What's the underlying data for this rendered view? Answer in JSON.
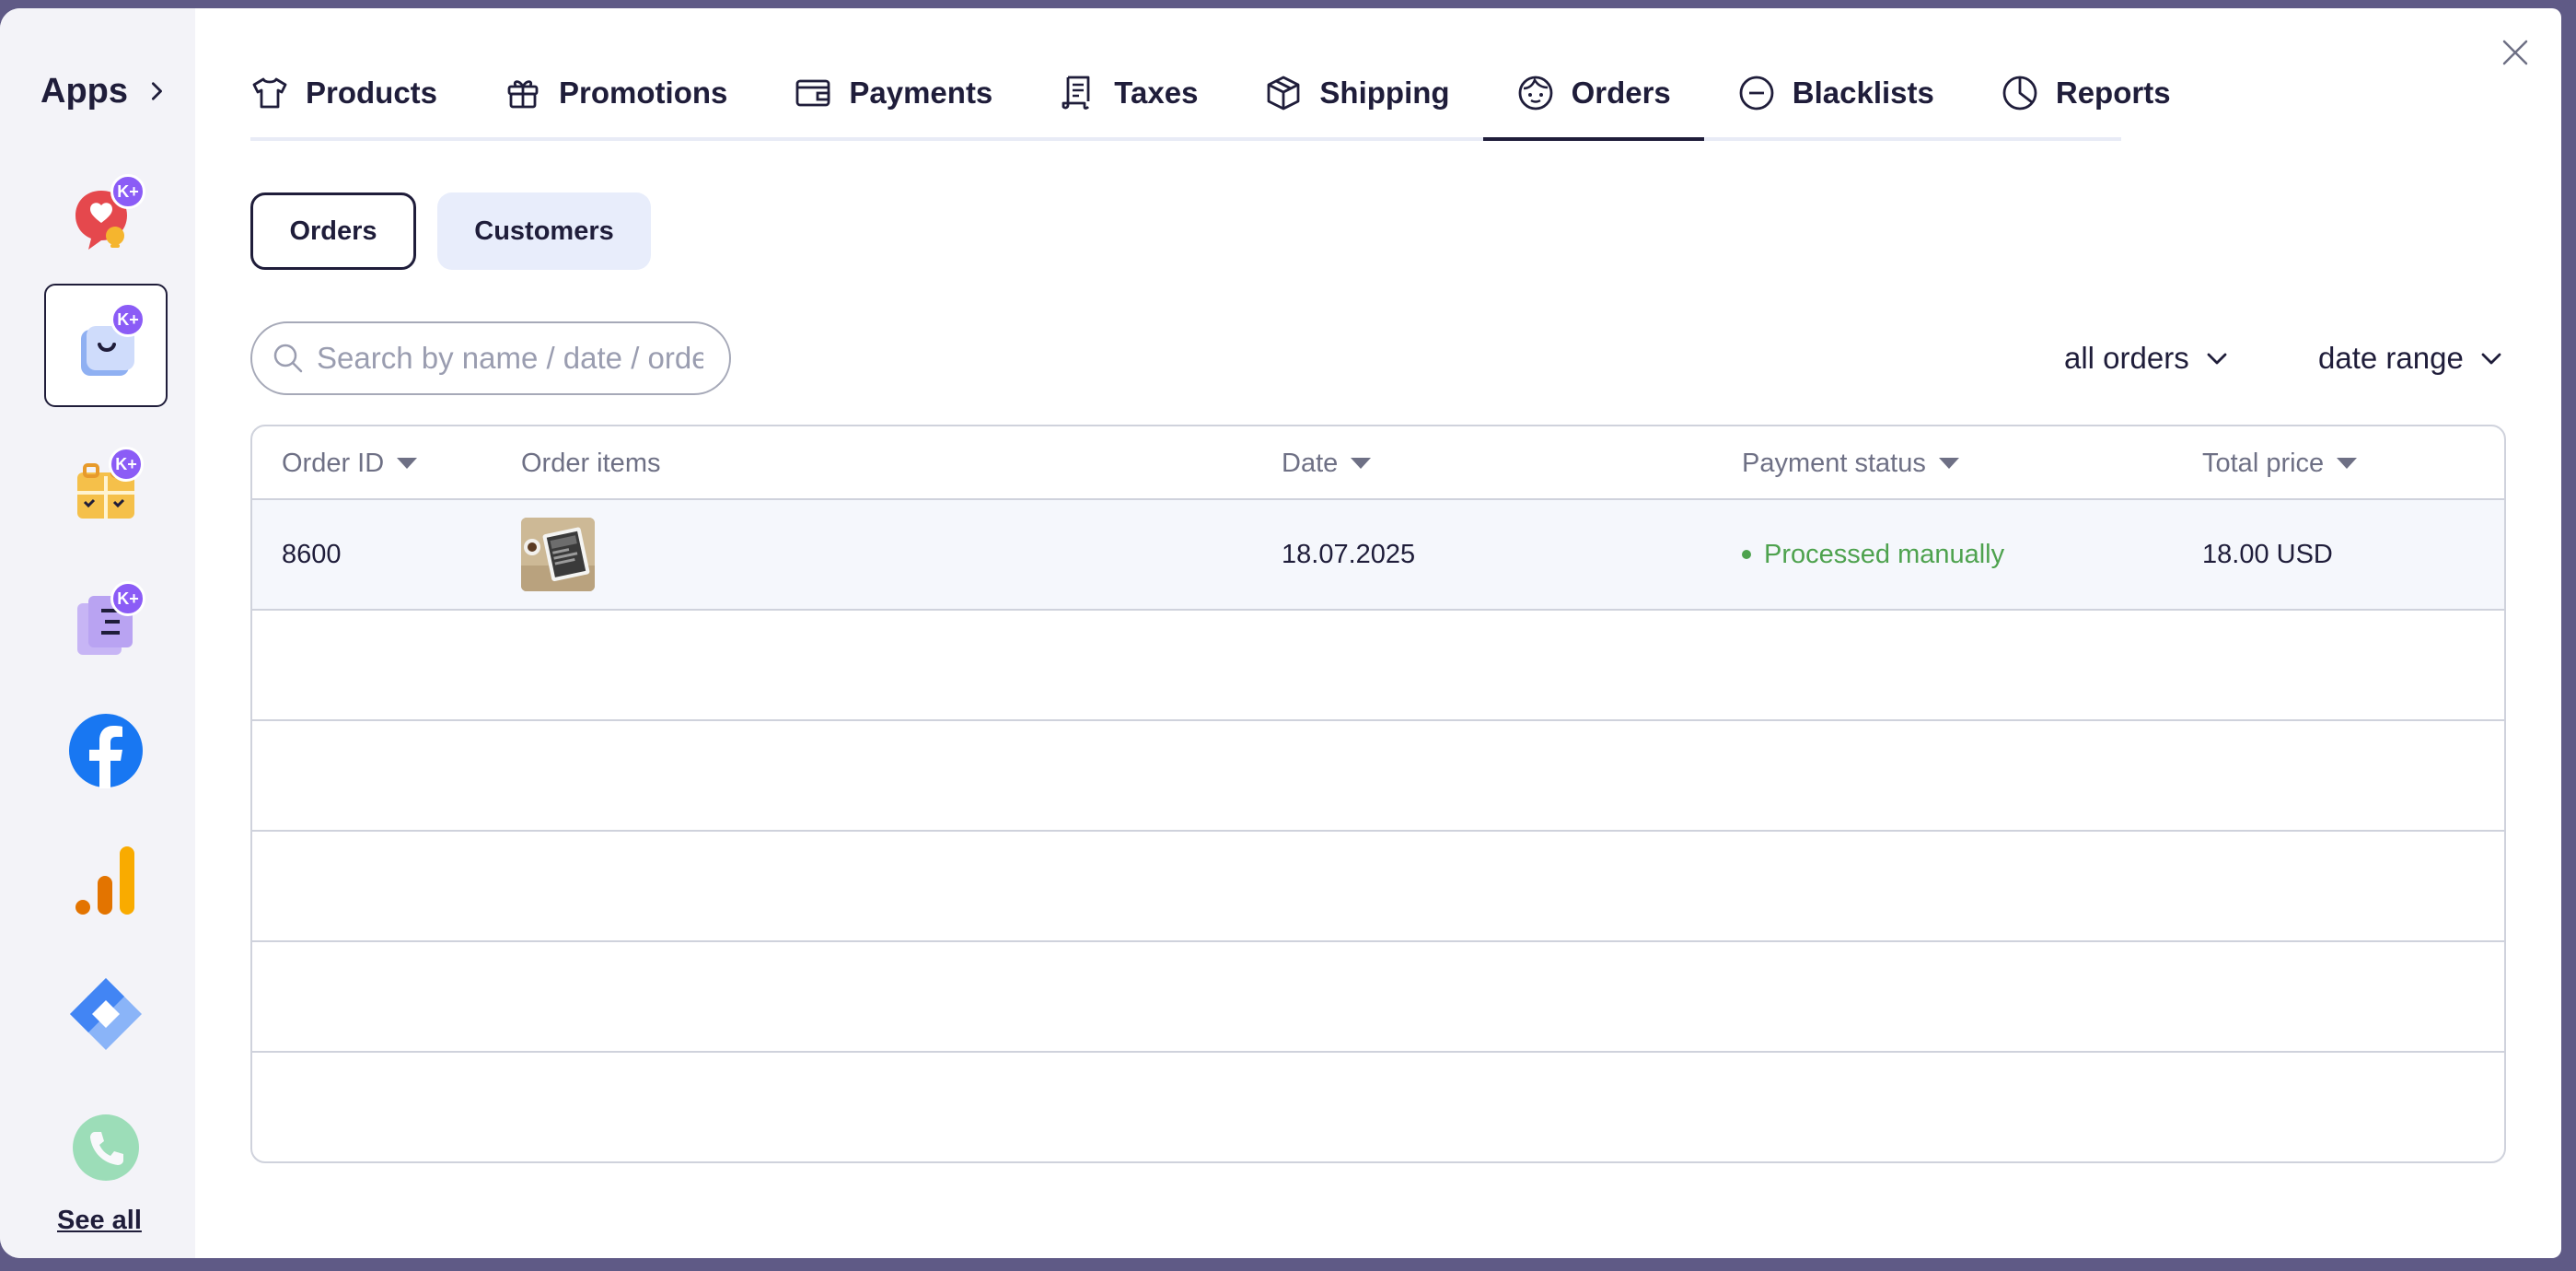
{
  "sidebar": {
    "title": "Apps",
    "see_all": "See all",
    "apps": [
      {
        "name": "notification-app",
        "badge": "K+"
      },
      {
        "name": "store-app",
        "badge": "K+"
      },
      {
        "name": "booking-app",
        "badge": "K+"
      },
      {
        "name": "forms-app",
        "badge": "K+"
      },
      {
        "name": "facebook-app"
      },
      {
        "name": "analytics-app"
      },
      {
        "name": "tag-manager-app"
      },
      {
        "name": "phone-app"
      }
    ]
  },
  "tabs": [
    {
      "label": "Products",
      "icon": "tshirt-icon"
    },
    {
      "label": "Promotions",
      "icon": "gift-icon"
    },
    {
      "label": "Payments",
      "icon": "wallet-icon"
    },
    {
      "label": "Taxes",
      "icon": "receipt-icon"
    },
    {
      "label": "Shipping",
      "icon": "box-icon"
    },
    {
      "label": "Orders",
      "icon": "face-icon",
      "active": true
    },
    {
      "label": "Blacklists",
      "icon": "minus-circle-icon"
    },
    {
      "label": "Reports",
      "icon": "pie-chart-icon"
    }
  ],
  "segments": {
    "orders": "Orders",
    "customers": "Customers"
  },
  "search": {
    "placeholder": "Search by name / date / order"
  },
  "filters": {
    "orders": "all orders",
    "date": "date range"
  },
  "table": {
    "headers": {
      "order_id": "Order ID",
      "items": "Order items",
      "date": "Date",
      "payment": "Payment status",
      "total": "Total price"
    },
    "rows": [
      {
        "order_id": "8600",
        "date": "18.07.2025",
        "payment": "Processed manually",
        "total": "18.00 USD"
      }
    ]
  },
  "colors": {
    "accent": "#1f1d3a",
    "status_ok": "#4ea24e",
    "badge": "#8b5cf6",
    "backdrop": "#5f5a86"
  }
}
